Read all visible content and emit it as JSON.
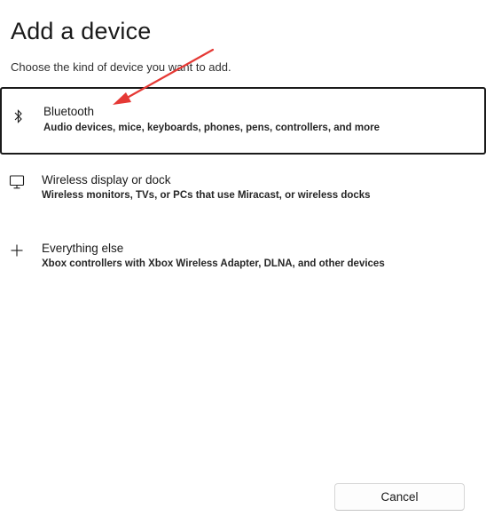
{
  "dialog": {
    "title": "Add a device",
    "subtitle": "Choose the kind of device you want to add."
  },
  "options": [
    {
      "title": "Bluetooth",
      "description": "Audio devices, mice, keyboards, phones, pens, controllers, and more",
      "icon": "bluetooth-icon",
      "selected": true
    },
    {
      "title": "Wireless display or dock",
      "description": "Wireless monitors, TVs, or PCs that use Miracast, or wireless docks",
      "icon": "monitor-icon",
      "selected": false
    },
    {
      "title": "Everything else",
      "description": "Xbox controllers with Xbox Wireless Adapter, DLNA, and other devices",
      "icon": "plus-icon",
      "selected": false
    }
  ],
  "footer": {
    "cancel_label": "Cancel"
  },
  "annotation": {
    "color": "#e53935"
  }
}
